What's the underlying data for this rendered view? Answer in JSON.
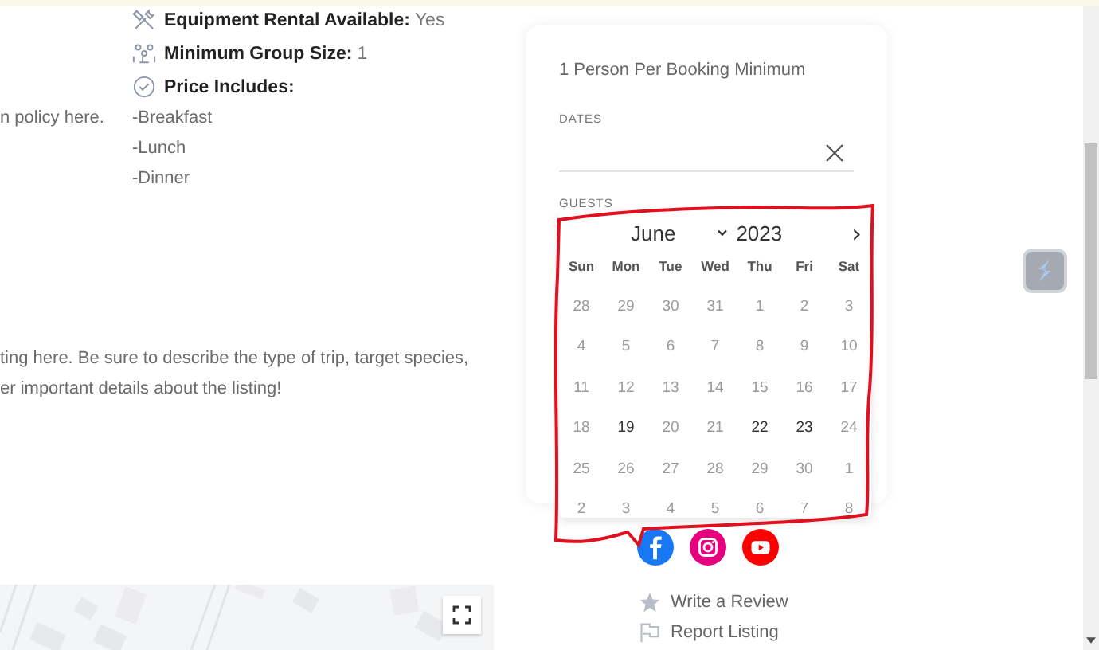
{
  "features": [
    {
      "kind": "tools",
      "label": "Equipment Rental Available:",
      "value": "Yes"
    },
    {
      "kind": "group",
      "label": "Minimum Group Size:",
      "value": "1"
    },
    {
      "kind": "check",
      "label": "Price Includes:"
    }
  ],
  "cancellation_text": "n policy here.",
  "includes": [
    "-Breakfast",
    "-Lunch",
    "-Dinner"
  ],
  "description_lines": [
    "ting here. Be sure to describe the type of trip, target species,",
    "er important details about the listing!"
  ],
  "booking": {
    "minimum_note": "1 Person Per Booking Minimum",
    "dates_label": "DATES",
    "guests_label": "GUESTS"
  },
  "calendar": {
    "month": "June",
    "year": "2023",
    "next": "›",
    "weekdays": [
      "Sun",
      "Mon",
      "Tue",
      "Wed",
      "Thu",
      "Fri",
      "Sat"
    ],
    "weeks": [
      [
        {
          "day": "28",
          "disabled": true
        },
        {
          "day": "29",
          "disabled": true
        },
        {
          "day": "30",
          "disabled": true
        },
        {
          "day": "31",
          "disabled": true
        },
        {
          "day": "1",
          "disabled": true
        },
        {
          "day": "2",
          "disabled": true
        },
        {
          "day": "3",
          "disabled": true
        }
      ],
      [
        {
          "day": "4",
          "disabled": true
        },
        {
          "day": "5",
          "disabled": true
        },
        {
          "day": "6",
          "disabled": true
        },
        {
          "day": "7",
          "disabled": true
        },
        {
          "day": "8",
          "disabled": true
        },
        {
          "day": "9",
          "disabled": true
        },
        {
          "day": "10",
          "disabled": true
        }
      ],
      [
        {
          "day": "11",
          "disabled": true
        },
        {
          "day": "12",
          "disabled": true
        },
        {
          "day": "13",
          "disabled": true
        },
        {
          "day": "14",
          "disabled": true
        },
        {
          "day": "15",
          "disabled": true
        },
        {
          "day": "16",
          "disabled": true
        },
        {
          "day": "17",
          "disabled": true
        }
      ],
      [
        {
          "day": "18",
          "disabled": true
        },
        {
          "day": "19",
          "disabled": false
        },
        {
          "day": "20",
          "disabled": true
        },
        {
          "day": "21",
          "disabled": true
        },
        {
          "day": "22",
          "disabled": false
        },
        {
          "day": "23",
          "disabled": false
        },
        {
          "day": "24",
          "disabled": true
        }
      ],
      [
        {
          "day": "25",
          "disabled": true
        },
        {
          "day": "26",
          "disabled": true
        },
        {
          "day": "27",
          "disabled": true
        },
        {
          "day": "28",
          "disabled": true
        },
        {
          "day": "29",
          "disabled": true
        },
        {
          "day": "30",
          "disabled": true
        },
        {
          "day": "1",
          "disabled": true
        }
      ],
      [
        {
          "day": "2",
          "disabled": true
        },
        {
          "day": "3",
          "disabled": true
        },
        {
          "day": "4",
          "disabled": true
        },
        {
          "day": "5",
          "disabled": true
        },
        {
          "day": "6",
          "disabled": true
        },
        {
          "day": "7",
          "disabled": true
        },
        {
          "day": "8",
          "disabled": true
        }
      ]
    ]
  },
  "social": [
    {
      "kind": "facebook",
      "color": "#1877f2"
    },
    {
      "kind": "instagram",
      "color": "#e6007e"
    },
    {
      "kind": "youtube",
      "color": "#ff0000"
    }
  ],
  "links": [
    {
      "kind": "review",
      "label": "Write a Review"
    },
    {
      "kind": "report",
      "label": "Report Listing"
    }
  ]
}
